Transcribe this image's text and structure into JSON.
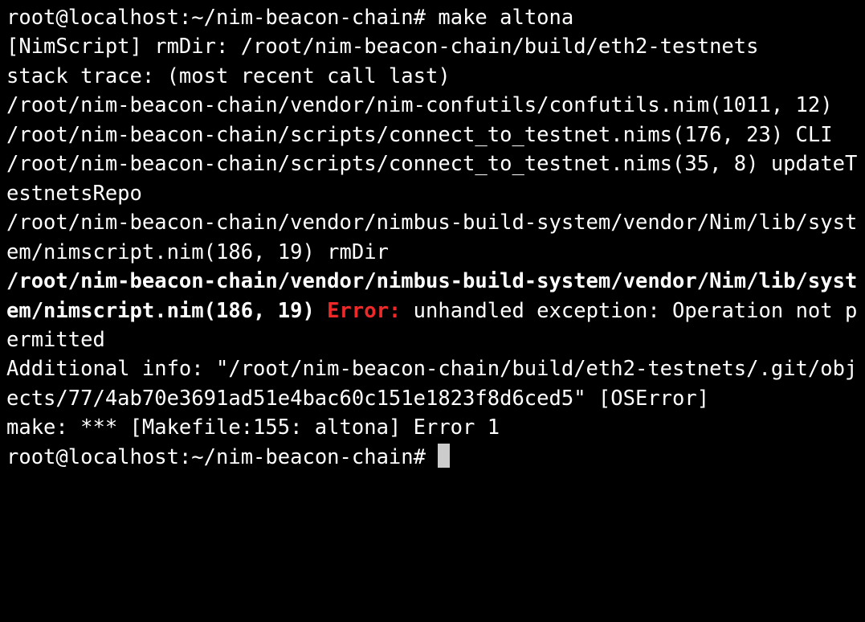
{
  "terminal": {
    "prompt1_prefix": "root@localhost",
    "prompt1_cwd": "~/nim-beacon-chain",
    "prompt1_sym": "#",
    "command": "make altona",
    "line2": "[NimScript] rmDir: /root/nim-beacon-chain/build/eth2-testnets",
    "line3": "stack trace: (most recent call last)",
    "line4": "/root/nim-beacon-chain/vendor/nim-confutils/confutils.nim(1011, 12)",
    "line5": "/root/nim-beacon-chain/scripts/connect_to_testnet.nims(176, 23) CLI",
    "line6": "/root/nim-beacon-chain/scripts/connect_to_testnet.nims(35, 8) updateTestnetsRepo",
    "line7": "/root/nim-beacon-chain/vendor/nimbus-build-system/vendor/Nim/lib/system/nimscript.nim(186, 19) rmDir",
    "line8_bold": "/root/nim-beacon-chain/vendor/nimbus-build-system/vendor/Nim/lib/system/nimscript.nim(186, 19) ",
    "line8_error": "Error:",
    "line8_rest": " unhandled exception: Operation not permitted",
    "line9": "Additional info: \"/root/nim-beacon-chain/build/eth2-testnets/.git/objects/77/4ab70e3691ad51e4bac60c151e1823f8d6ced5\" [OSError]",
    "line10": "make: *** [Makefile:155: altona] Error 1",
    "prompt2_prefix": "root@localhost",
    "prompt2_cwd": "~/nim-beacon-chain",
    "prompt2_sym": "#"
  }
}
